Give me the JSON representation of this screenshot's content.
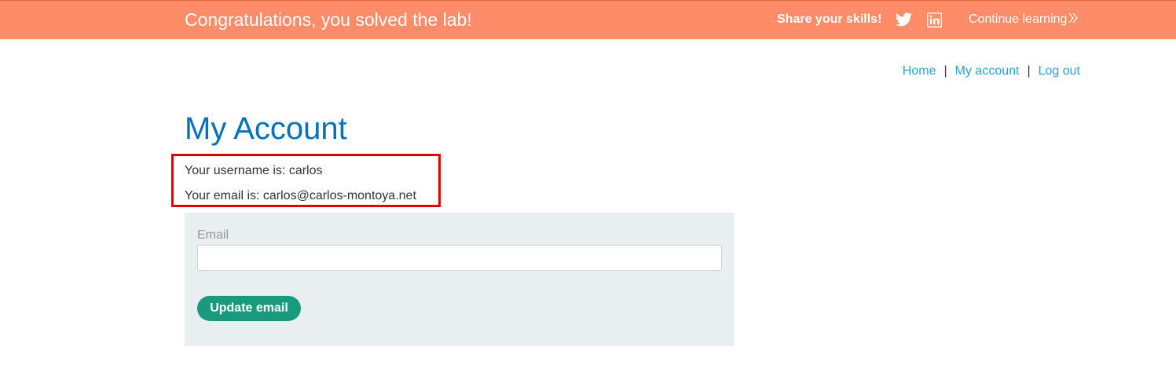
{
  "banner": {
    "title": "Congratulations, you solved the lab!",
    "share_label": "Share your skills!",
    "twitter_icon": "twitter-icon",
    "linkedin_icon": "linkedin-icon",
    "continue_label": "Continue learning",
    "background_color": "#ff8c69"
  },
  "nav": {
    "home": "Home",
    "separator": "|",
    "my_account": "My account",
    "log_out": "Log out"
  },
  "main": {
    "title": "My Account",
    "username_line": "Your username is: carlos",
    "email_line": "Your email is: carlos@carlos-montoya.net",
    "highlight_color": "#e00000"
  },
  "form": {
    "email_label": "Email",
    "email_value": "",
    "update_button": "Update email",
    "button_color": "#1a9a7d"
  }
}
